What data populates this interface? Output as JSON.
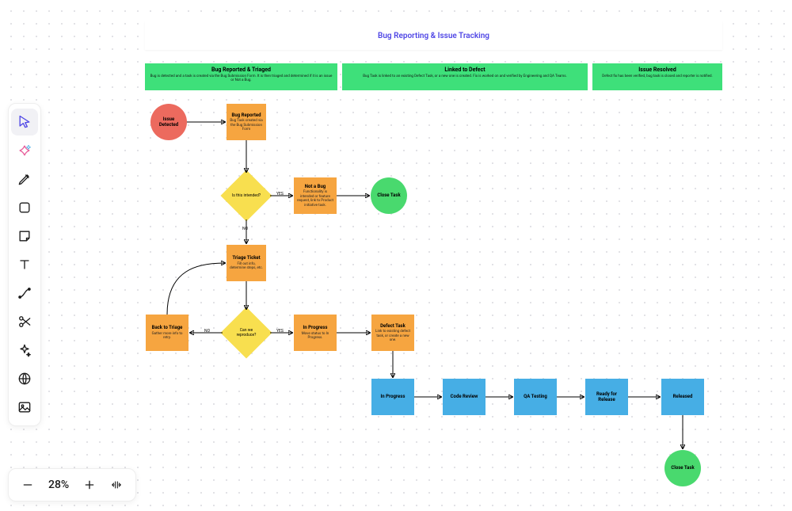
{
  "title": "Bug Reporting & Issue Tracking",
  "phases": {
    "triaged": {
      "title": "Bug Reported & Triaged",
      "desc": "Bug is detected and a task is created via the Bug Submission Form. It is then triaged and determined if it is an issue or Not a Bug."
    },
    "linked": {
      "title": "Linked to Defect",
      "desc": "Bug Task is linked to an existing Defect Task, or a new one is created. Fix is worked on and verified by Engineering and QA Teams."
    },
    "resolved": {
      "title": "Issue Resolved",
      "desc": "Defect fix has been verified, bug task is closed and reporter is notified."
    }
  },
  "nodes": {
    "issue_detected": {
      "title": "Issue Detected"
    },
    "bug_reported": {
      "title": "Bug Reported",
      "desc": "Bug Task created via the Bug Submission Form"
    },
    "decision_intended": {
      "label": "Is this intended?"
    },
    "not_a_bug": {
      "title": "Not a Bug",
      "desc": "Functionality is intended or feature request, link to Product initiative task."
    },
    "close_task_1": {
      "title": "Close Task"
    },
    "triage_ticket": {
      "title": "Triage Ticket",
      "desc": "Fill out info, determine steps, etc."
    },
    "decision_repro": {
      "label": "Can we reproduce?"
    },
    "back_to_triage": {
      "title": "Back to Triage",
      "desc": "Gather more info to retry."
    },
    "in_progress_1": {
      "title": "In Progress",
      "desc": "Move status to In Progress."
    },
    "defect_task": {
      "title": "Defect Task",
      "desc": "Link to existing defect task, or create a new one."
    },
    "in_progress_2": {
      "title": "In Progress"
    },
    "code_review": {
      "title": "Code Review"
    },
    "qa_testing": {
      "title": "QA Testing"
    },
    "ready_release": {
      "title": "Ready for Release"
    },
    "released": {
      "title": "Released"
    },
    "close_task_2": {
      "title": "Close Task"
    }
  },
  "edge_labels": {
    "yes1": "YES",
    "no1": "NO",
    "yes2": "YES",
    "no2": "NO"
  },
  "toolbar": {
    "select": "Select",
    "ai": "AI",
    "pen": "Pen",
    "shape": "Shape",
    "note": "Sticky note",
    "text": "Text",
    "connector": "Connector",
    "scissors": "Scissors",
    "sparkle": "Magic",
    "globe": "Web",
    "image": "Image"
  },
  "zoom": {
    "minus": "−",
    "value": "28%",
    "plus": "+",
    "fit": "Fit"
  }
}
